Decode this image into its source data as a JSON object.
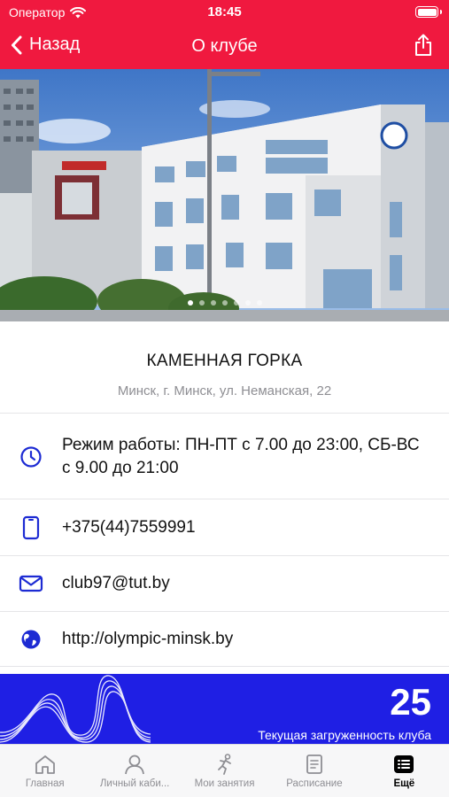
{
  "status_bar": {
    "carrier": "Оператор",
    "time": "18:45",
    "battery_level": 1.0
  },
  "nav": {
    "back_label": "Назад",
    "title": "О клубе"
  },
  "gallery": {
    "page_count": 7,
    "current_page": 1
  },
  "club": {
    "name": "КАМЕННАЯ ГОРКА",
    "address": "Минск, г. Минск, ул. Неманская, 22"
  },
  "contacts": {
    "hours": "Режим работы: ПН-ПТ с 7.00 до 23:00, СБ-ВС с 9.00 до 21:00",
    "phone": "+375(44)7559991",
    "email": "club97@tut.by",
    "website": "http://olympic-minsk.by"
  },
  "load": {
    "value": "25",
    "label": "Текущая загруженность клуба"
  },
  "tabs": [
    {
      "label": "Главная",
      "icon": "home-icon"
    },
    {
      "label": "Личный каби...",
      "icon": "person-icon"
    },
    {
      "label": "Мои занятия",
      "icon": "runner-icon"
    },
    {
      "label": "Расписание",
      "icon": "document-icon"
    },
    {
      "label": "Ещё",
      "icon": "list-icon"
    }
  ],
  "colors": {
    "brand_red": "#f0193f",
    "accent_blue": "#1f1fe4",
    "icon_blue": "#1d2bd3"
  }
}
